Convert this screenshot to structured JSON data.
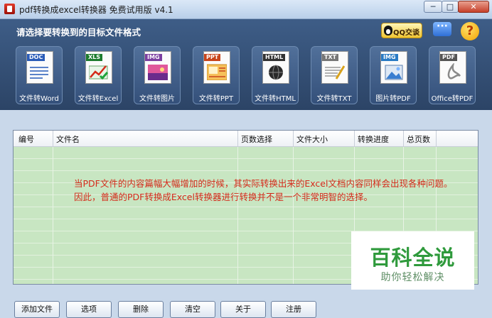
{
  "window": {
    "title": "pdf转换成excel转换器 免费试用版 v4.1",
    "min_glyph": "─",
    "max_glyph": "□",
    "close_glyph": "✕"
  },
  "header": {
    "prompt": "请选择要转换到的目标文件格式",
    "qq_label": "QQ交谈",
    "help_glyph": "?"
  },
  "formats": [
    {
      "tag": "DOC",
      "label": "文件转Word",
      "color": "#2a5cb8"
    },
    {
      "tag": "XLS",
      "label": "文件转Excel",
      "color": "#1d7c2e"
    },
    {
      "tag": "IMG",
      "label": "文件转图片",
      "color": "#7c3fa0"
    },
    {
      "tag": "PPT",
      "label": "文件转PPT",
      "color": "#c8451c"
    },
    {
      "tag": "HTML",
      "label": "文件转HTML",
      "color": "#333333"
    },
    {
      "tag": "TXT",
      "label": "文件转TXT",
      "color": "#777777"
    },
    {
      "tag": "IMG",
      "label": "图片转PDF",
      "color": "#2a7bc4"
    },
    {
      "tag": "PDF",
      "label": "Office转PDF",
      "color": "#555555"
    }
  ],
  "table": {
    "columns": [
      "编号",
      "文件名",
      "页数选择",
      "文件大小",
      "转换进度",
      "总页数"
    ]
  },
  "message": {
    "line1": "当PDF文件的内容篇幅大幅增加的时候，其实际转换出来的Excel文档内容同样会出现各种问题。",
    "line2": "因此，普通的PDF转换成Excel转换器进行转换并不是一个非常明智的选择。"
  },
  "watermark": {
    "title": "百科全说",
    "subtitle": "助你轻松解决"
  },
  "bottom_buttons": [
    "添加文件",
    "选项",
    "删除",
    "清空",
    "关于",
    "注册"
  ]
}
